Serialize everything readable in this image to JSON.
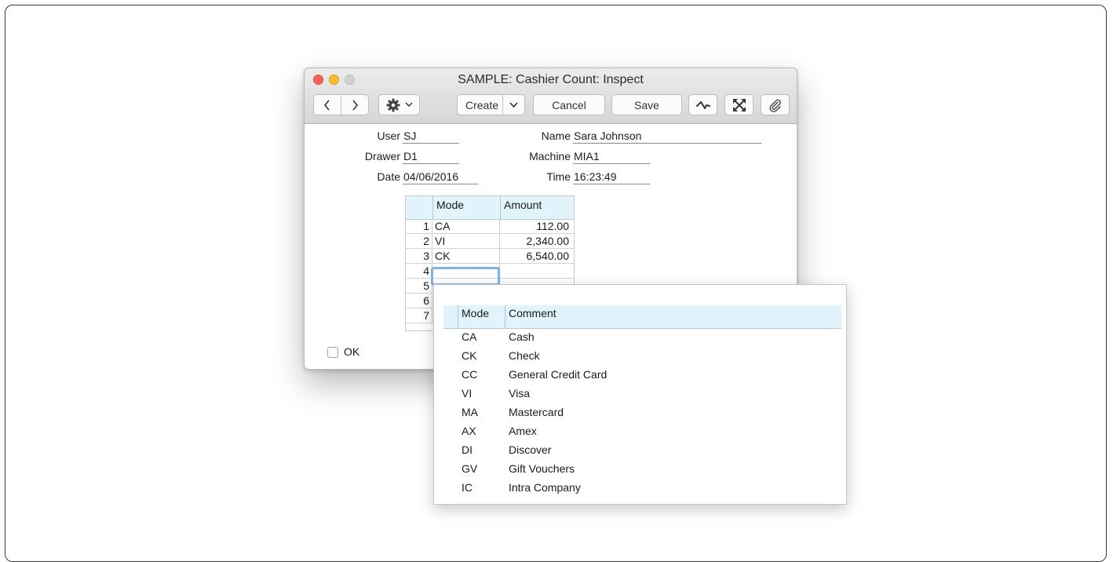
{
  "window": {
    "title": "SAMPLE: Cashier Count: Inspect"
  },
  "toolbar": {
    "create_label": "Create",
    "cancel_label": "Cancel",
    "save_label": "Save"
  },
  "form": {
    "user_label": "User",
    "user_value": "SJ",
    "name_label": "Name",
    "name_value": "Sara Johnson",
    "drawer_label": "Drawer",
    "drawer_value": "D1",
    "machine_label": "Machine",
    "machine_value": "MIA1",
    "date_label": "Date",
    "date_value": "04/06/2016",
    "time_label": "Time",
    "time_value": "16:23:49"
  },
  "grid": {
    "headers": {
      "mode": "Mode",
      "amount": "Amount"
    },
    "rows": [
      {
        "num": "1",
        "mode": "CA",
        "amount": "112.00"
      },
      {
        "num": "2",
        "mode": "VI",
        "amount": "2,340.00"
      },
      {
        "num": "3",
        "mode": "CK",
        "amount": "6,540.00"
      },
      {
        "num": "4",
        "mode": "",
        "amount": ""
      },
      {
        "num": "5",
        "mode": "",
        "amount": ""
      },
      {
        "num": "6",
        "mode": "",
        "amount": ""
      },
      {
        "num": "7",
        "mode": "",
        "amount": ""
      }
    ]
  },
  "ok_label": "OK",
  "popup": {
    "headers": {
      "mode": "Mode",
      "comment": "Comment"
    },
    "rows": [
      {
        "mode": "CA",
        "comment": "Cash"
      },
      {
        "mode": "CK",
        "comment": "Check"
      },
      {
        "mode": "CC",
        "comment": "General Credit Card"
      },
      {
        "mode": "VI",
        "comment": "Visa"
      },
      {
        "mode": "MA",
        "comment": "Mastercard"
      },
      {
        "mode": "AX",
        "comment": "Amex"
      },
      {
        "mode": "DI",
        "comment": "Discover"
      },
      {
        "mode": "GV",
        "comment": "Gift Vouchers"
      },
      {
        "mode": "IC",
        "comment": "Intra Company"
      }
    ]
  },
  "icons": {
    "back": "chevron-left-icon",
    "forward": "chevron-right-icon",
    "actions": "gear-icon",
    "activity": "activity-icon",
    "expand": "expand-icon",
    "attach": "paperclip-icon"
  },
  "colors": {
    "header_bg": "#e1f3fb",
    "focus_ring": "#7fb2ee",
    "close": "#fc5f57",
    "minimize": "#fdbc2e"
  }
}
